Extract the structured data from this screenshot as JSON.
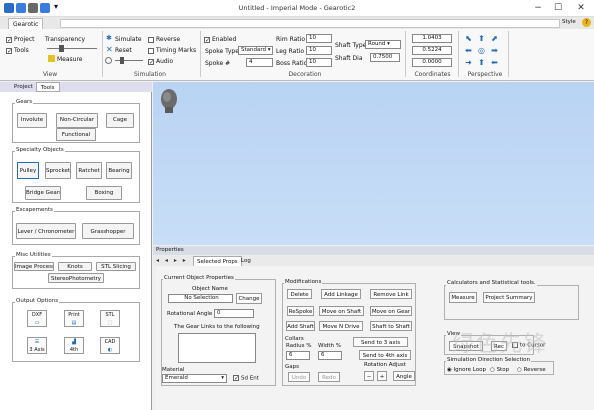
{
  "window": {
    "title": "Untitled - Imperial Mode - Gearotic2",
    "search_placeholder": "",
    "style_label": "Style",
    "help_label": "?"
  },
  "ribbon": {
    "tab": "Gearotic",
    "view": {
      "label": "View",
      "project": "Project",
      "tools": "Tools",
      "transparency": "Transparency",
      "measure": "Measure"
    },
    "simulation": {
      "label": "Simulation",
      "simulate": "Simulate",
      "reset": "Reset",
      "reverse": "Reverse",
      "timing_marks": "Timing Marks",
      "audio": "Audio"
    },
    "decoration": {
      "label": "Decoration",
      "enabled": "Enabled",
      "spoke_type_label": "Spoke Type",
      "spoke_type_value": "Standard",
      "spoke_num_label": "Spoke #",
      "spoke_num_value": "4",
      "rim_ratio_label": "Rim Ratio",
      "rim_ratio_value": "10",
      "leg_ratio_label": "Leg Ratio",
      "leg_ratio_value": "10",
      "boss_ratio_label": "Boss Ratio",
      "boss_ratio_value": "10",
      "shaft_type_label": "Shaft Type",
      "shaft_type_value": "Round",
      "shaft_dia_label": "Shaft Dia",
      "shaft_dia_value": "0.7500"
    },
    "coordinates": {
      "label": "Coordinates",
      "x": "1.0403",
      "y": "0.5224",
      "z": "0.0000"
    },
    "perspective": {
      "label": "Perspective"
    }
  },
  "left_panel": {
    "tabs": [
      "Project",
      "Tools"
    ],
    "gears": {
      "title": "Gears",
      "buttons": [
        "Involute",
        "Non-Circular",
        "Cage",
        "Functional"
      ]
    },
    "specialty": {
      "title": "Specialty Objects",
      "buttons": [
        "Pulley",
        "Sprocket",
        "Ratchet",
        "Bearing",
        "Bridge Gears",
        "Boxing"
      ]
    },
    "escapements": {
      "title": "Escapements",
      "buttons": [
        "Lever / Chronometer",
        "Grasshopper"
      ]
    },
    "misc": {
      "title": "Misc Utilities",
      "buttons": [
        "Image Process",
        "Knots",
        "STL Slicing",
        "StereoPhotometry"
      ]
    },
    "output": {
      "title": "Output Options",
      "icons": [
        "DXF",
        "Print",
        "STL",
        "3 Axis",
        "4th",
        "CAD"
      ]
    }
  },
  "properties": {
    "title": "Properties",
    "tabs": [
      "Selected Props",
      "Log"
    ],
    "current": {
      "title": "Current Object Properties",
      "object_name_label": "Object Name",
      "object_name_value": "No Selection",
      "change_button": "Change",
      "rotational_angle_label": "Rotational Angle",
      "rotational_angle_value": "0",
      "links_label": "The Gear Links to the following",
      "material_label": "Material",
      "material_value": "Emerald",
      "sd_ent": "Sd Ent"
    },
    "modifications": {
      "title": "Modifications",
      "buttons": [
        "Delete",
        "Add Linkage",
        "Remove Link",
        "ReSpoke",
        "Move on Shaft",
        "Move on Gear",
        "Add Shaft",
        "Move N Drive",
        "Shaft to Shaft"
      ],
      "collars_label": "Collars",
      "radius_label": "Radius %",
      "radius_value": "6",
      "width_label": "Width %",
      "width_value": "6",
      "gaps_label": "Gaps",
      "undo": "Undo",
      "redo": "Redo",
      "send_3": "Send to 3 axis",
      "send_4": "Send to 4th axis",
      "rotation_label": "Rotation Adjust",
      "minus": "−",
      "plus": "+",
      "angle": "Angle"
    },
    "calc": {
      "title": "Calculators and Statistical tools.",
      "measure": "Measure",
      "summary": "Project Summary"
    },
    "view": {
      "title": "View",
      "snapshot": "Snapshot",
      "rec": "Rec",
      "to_cursor": "to Cursor"
    },
    "sim_selection": {
      "title": "Simulation Direction Selection",
      "options": [
        "Ignore Loop",
        "Stop",
        "Reverse"
      ]
    }
  },
  "watermark": "绿色先锋"
}
